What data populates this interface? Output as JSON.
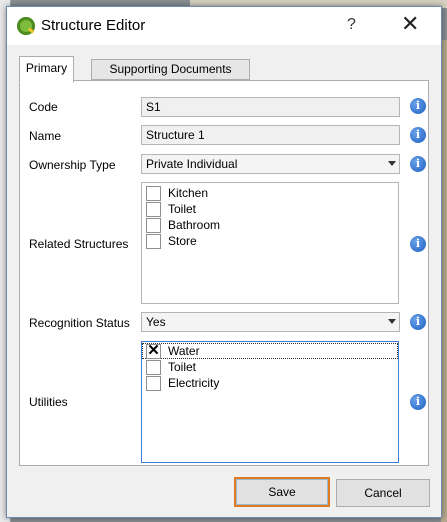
{
  "window": {
    "title": "Structure Editor",
    "help": "?",
    "close": "✕"
  },
  "tabs": [
    {
      "label": "Primary",
      "active": true
    },
    {
      "label": "Supporting Documents",
      "active": false
    }
  ],
  "fields": {
    "code": {
      "label": "Code",
      "value": "S1"
    },
    "name": {
      "label": "Name",
      "value": "Structure 1"
    },
    "ownership": {
      "label": "Ownership Type",
      "value": "Private Individual"
    },
    "related": {
      "label": "Related Structures",
      "items": [
        {
          "label": "Kitchen",
          "checked": false
        },
        {
          "label": "Toilet",
          "checked": false
        },
        {
          "label": "Bathroom",
          "checked": false
        },
        {
          "label": "Store",
          "checked": false
        }
      ]
    },
    "recognition": {
      "label": "Recognition Status",
      "value": "Yes"
    },
    "utilities": {
      "label": "Utilities",
      "items": [
        {
          "label": "Water",
          "checked": true
        },
        {
          "label": "Toilet",
          "checked": false
        },
        {
          "label": "Electricity",
          "checked": false
        }
      ]
    }
  },
  "info_icon_glyph": "i",
  "buttons": {
    "save": "Save",
    "cancel": "Cancel"
  },
  "colors": {
    "accent_focus": "#e07b22",
    "info": "#1d5fc4"
  }
}
